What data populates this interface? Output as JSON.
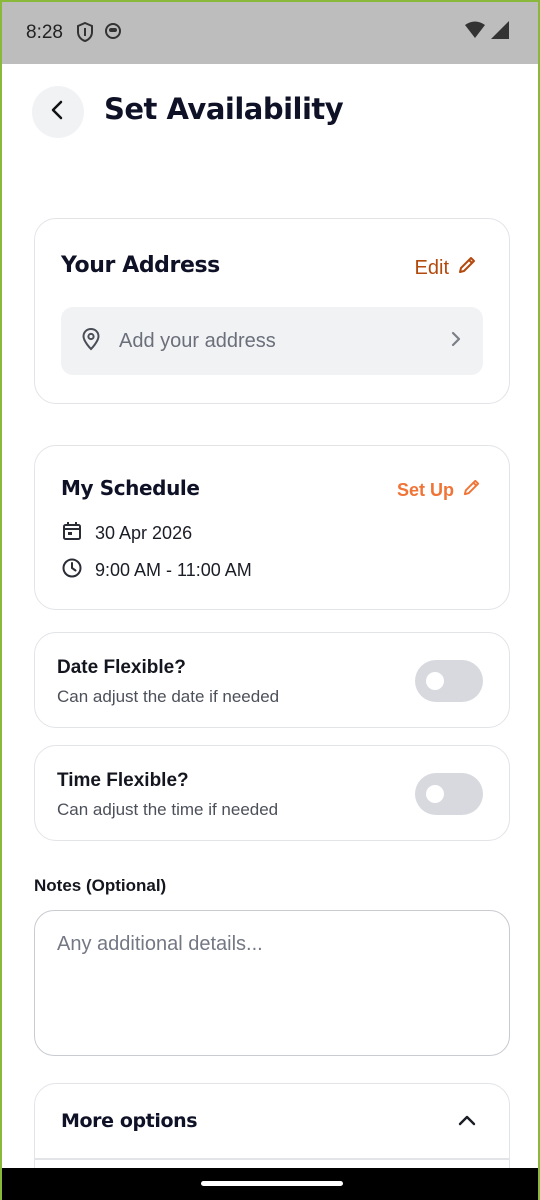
{
  "status_bar": {
    "time": "8:28",
    "icons_left": [
      "shield-icon",
      "face-icon"
    ],
    "icons_right": [
      "wifi-icon",
      "signal-icon"
    ]
  },
  "header": {
    "title": "Set Availability",
    "back_icon": "chevron-left-icon"
  },
  "address": {
    "title": "Your Address",
    "edit_label": "Edit",
    "placeholder": "Add your address",
    "accent": "#b4490e"
  },
  "schedule": {
    "title": "My Schedule",
    "setup_label": "Set Up",
    "date": "30 Apr 2026",
    "time": "9:00 AM - 11:00 AM",
    "accent": "#f07436"
  },
  "flex_options": [
    {
      "title": "Date Flexible?",
      "subtitle": "Can adjust the date if needed",
      "enabled": false
    },
    {
      "title": "Time Flexible?",
      "subtitle": "Can adjust the time if needed",
      "enabled": false
    }
  ],
  "notes": {
    "label": "Notes (Optional)",
    "placeholder": "Any additional details...",
    "value": ""
  },
  "more_options": {
    "title": "More options",
    "expanded": true
  }
}
